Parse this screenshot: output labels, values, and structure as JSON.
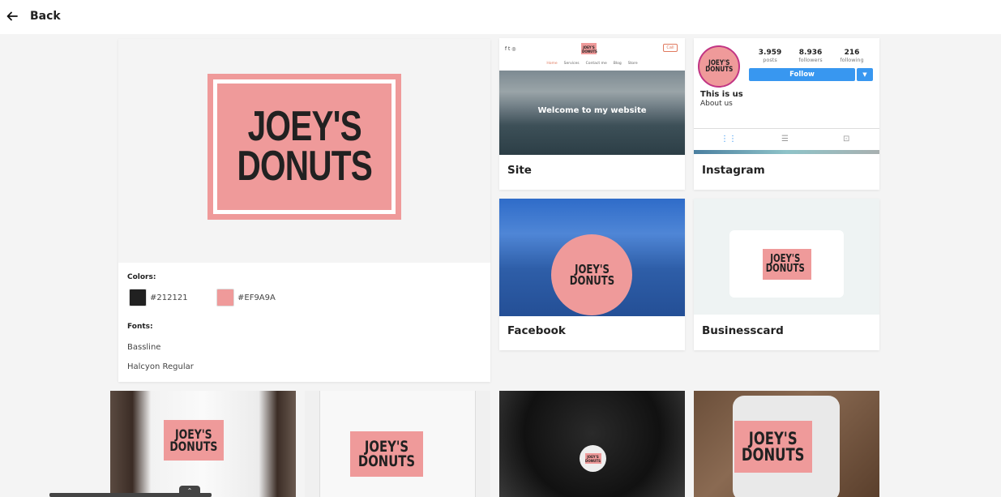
{
  "header": {
    "back_label": "Back"
  },
  "brand": {
    "logo_line1": "JOEY'S",
    "logo_line2": "DONUTS",
    "colors_label": "Colors:",
    "colors": [
      {
        "hex": "#212121",
        "label": "#212121"
      },
      {
        "hex": "#EF9A9A",
        "label": "#EF9A9A"
      }
    ],
    "fonts_label": "Fonts:",
    "fonts": [
      "Bassline",
      "Halcyon Regular"
    ]
  },
  "cards": {
    "site": {
      "title": "Site",
      "call_label": "Call",
      "nav_items": [
        "Home",
        "Services",
        "Contact me",
        "Blog",
        "Store"
      ],
      "hero_text": "Welcome to my website"
    },
    "instagram": {
      "title": "Instagram",
      "stats": [
        {
          "value": "3.959",
          "label": "posts"
        },
        {
          "value": "8.936",
          "label": "followers"
        },
        {
          "value": "216",
          "label": "following"
        }
      ],
      "follow_label": "Follow",
      "bio_name": "This is us",
      "bio_text": "About us"
    },
    "facebook": {
      "title": "Facebook"
    },
    "businesscard": {
      "title": "Businesscard"
    }
  },
  "accent_color": "#EF9A9A",
  "dark_color": "#212121"
}
